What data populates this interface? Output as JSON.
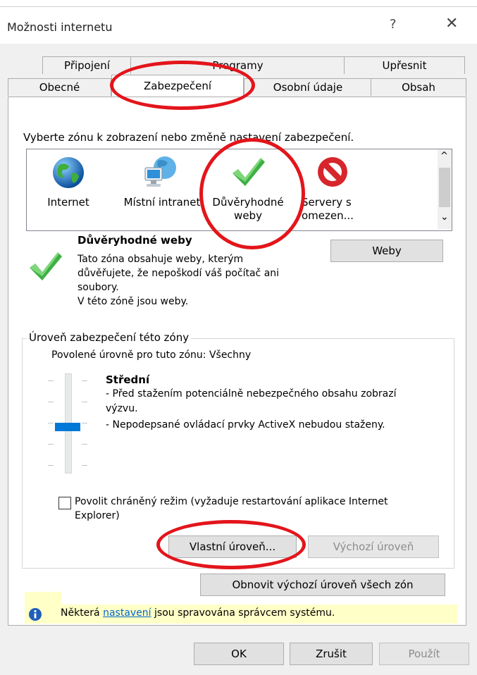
{
  "window": {
    "title": "Možnosti internetu",
    "help_glyph": "?",
    "close_glyph": "✕"
  },
  "tabs": {
    "row1": [
      "Připojení",
      "Programy",
      "Upřesnit"
    ],
    "row2": [
      "Obecné",
      "Zabezpečení",
      "Osobní údaje",
      "Obsah"
    ],
    "active": "Zabezpečení"
  },
  "security": {
    "zone_prompt": "Vyberte zónu k zobrazení nebo změně nastavení zabezpečení.",
    "zones": [
      {
        "label_line1": "Internet",
        "label_line2": "",
        "icon": "globe-icon"
      },
      {
        "label_line1": "Místní intranet",
        "label_line2": "",
        "icon": "intranet-icon"
      },
      {
        "label_line1": "Důvěryhodné",
        "label_line2": "weby",
        "icon": "checkmark-icon"
      },
      {
        "label_line1": "Servery s",
        "label_line2": "omezen...",
        "icon": "restricted-icon"
      }
    ],
    "scroll_up": "^",
    "scroll_down": "⌄",
    "zone_title": "Důvěryhodné weby",
    "zone_desc_line1": "Tato zóna obsahuje weby, kterým",
    "zone_desc_line2": "důvěřujete, že nepoškodí váš počítač ani",
    "zone_desc_line3": "soubory.",
    "zone_desc_line4": "V této zóně jsou weby.",
    "sites_button": "Weby"
  },
  "level": {
    "group_title": "Úroveň zabezpečení této zóny",
    "allowed_levels": "Povolené úrovně pro tuto zónu: Všechny",
    "level_name": "Střední",
    "desc1a": "- Před stažením potenciálně nebezpečného obsahu zobrazí",
    "desc1b": "výzvu.",
    "desc2": "- Nepodepsané ovládací prvky ActiveX nebudou staženy.",
    "protected_mode_line1": "Povolit chráněný režim (vyžaduje restartování aplikace Internet",
    "protected_mode_line2": "Explorer)",
    "custom_level": "Vlastní úroveň...",
    "default_level": "Výchozí úroveň",
    "slider_level_fraction": 0.5
  },
  "reset_all": "Obnovit výchozí úroveň všech zón",
  "info": {
    "prefix": "Některá ",
    "link": "nastavení",
    "suffix": " jsou spravována správcem systému."
  },
  "footer": {
    "ok": "OK",
    "cancel": "Zrušit",
    "apply": "Použít"
  },
  "colors": {
    "annotation_red": "#e3151b",
    "link_blue": "#0066cc",
    "info_yellow": "#ffffc8"
  }
}
